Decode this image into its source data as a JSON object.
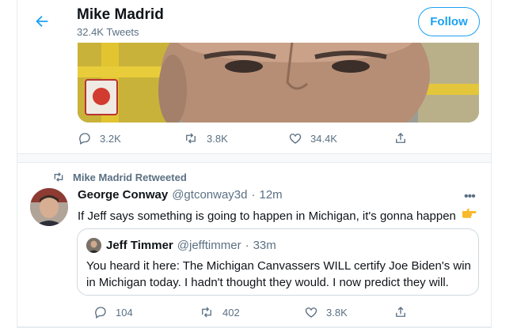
{
  "header": {
    "name": "Mike Madrid",
    "tweet_count": "32.4K Tweets",
    "follow_label": "Follow"
  },
  "tweet1": {
    "replies": "3.2K",
    "retweets": "3.8K",
    "likes": "34.4K"
  },
  "tweet2": {
    "retweeted_by": "Mike Madrid Retweeted",
    "author_name": "George Conway",
    "author_handle": "@gtconway3d",
    "dot": "·",
    "time": "12m",
    "text": "If Jeff says something is going to happen in Michigan, it's gonna happen",
    "emoji": "👉",
    "quote": {
      "author_name": "Jeff Timmer",
      "author_handle": "@jefftimmer",
      "dot": "·",
      "time": "33m",
      "text": "You heard it here: The Michigan Canvassers WILL certify Joe Biden's win in Michigan today. I hadn't thought they would. I now predict they will."
    },
    "replies": "104",
    "retweets": "402",
    "likes": "3.8K"
  },
  "colors": {
    "accent": "#1da1f2",
    "muted": "#5b7083",
    "border": "#e6ecf0"
  },
  "icons": [
    "back-arrow-icon",
    "reply-icon",
    "retweet-icon",
    "like-icon",
    "share-icon",
    "more-icon"
  ]
}
